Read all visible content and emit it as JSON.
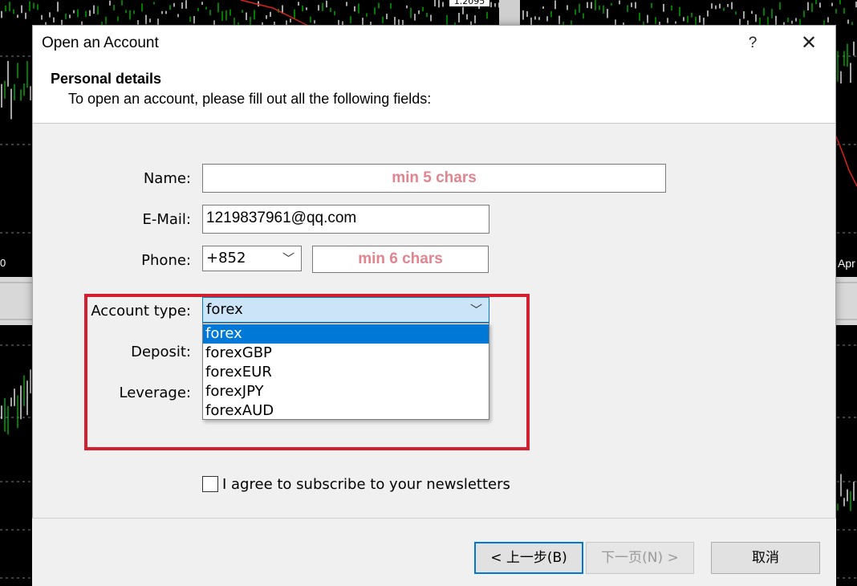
{
  "background": {
    "price_label": "1.2095",
    "axis_label_left": "0",
    "axis_label_right": "Apr"
  },
  "dialog": {
    "title": "Open an Account",
    "help_label": "?",
    "close_label": "✕",
    "section_title": "Personal details",
    "section_subtitle": "To open an account, please fill out all the following fields:"
  },
  "form": {
    "name": {
      "label": "Name:",
      "value": "",
      "placeholder": "min 5 chars"
    },
    "email": {
      "label": "E-Mail:",
      "value": "1219837961@qq.com"
    },
    "phone": {
      "label": "Phone:",
      "country_code": "+852",
      "value": "",
      "placeholder": "min 6 chars"
    },
    "account_type": {
      "label": "Account type:",
      "selected": "forex",
      "options": [
        "forex",
        "forexGBP",
        "forexEUR",
        "forexJPY",
        "forexAUD"
      ],
      "selected_index": 0
    },
    "deposit": {
      "label": "Deposit:"
    },
    "leverage": {
      "label": "Leverage:"
    },
    "newsletter": {
      "label": "I agree to subscribe to your newsletters",
      "checked": false
    }
  },
  "buttons": {
    "back": "< 上一步(B)",
    "next": "下一页(N) >",
    "cancel": "取消"
  },
  "colors": {
    "accent": "#0078d7",
    "highlight_box": "#d32030",
    "placeholder": "#e0848e",
    "candle_up": "#00c000",
    "candle_down": "#ffffff",
    "ma_line": "#e02020",
    "grid": "#ffffff"
  }
}
